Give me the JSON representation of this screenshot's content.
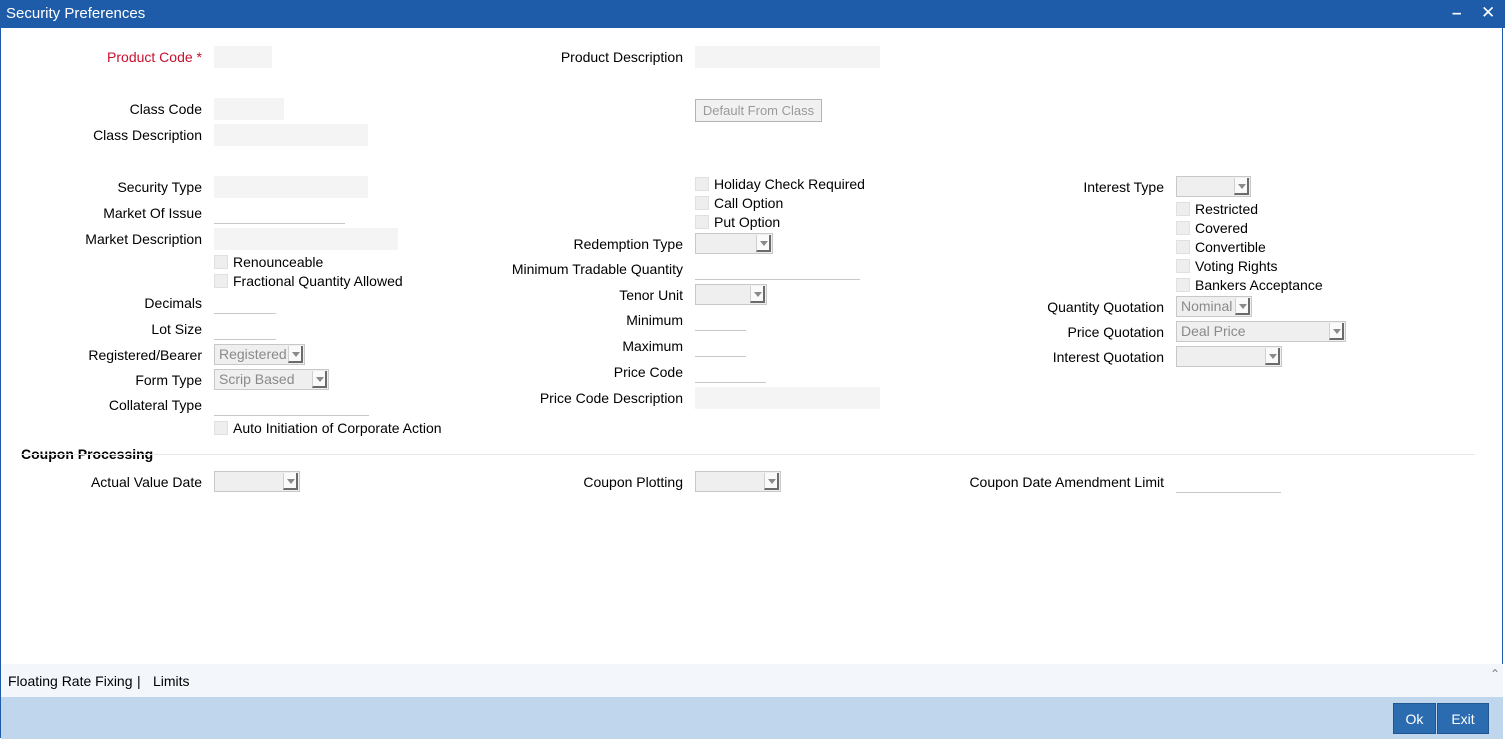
{
  "window": {
    "title": "Security Preferences",
    "minimize_icon": "minimize-icon",
    "close_icon": "close-icon"
  },
  "fields": {
    "product_code": {
      "label": "Product Code",
      "required_mark": "*"
    },
    "product_description": {
      "label": "Product Description"
    },
    "class_code": {
      "label": "Class Code"
    },
    "default_from_class": {
      "label": "Default From Class"
    },
    "class_description": {
      "label": "Class Description"
    },
    "security_type": {
      "label": "Security Type"
    },
    "market_of_issue": {
      "label": "Market Of Issue"
    },
    "market_description": {
      "label": "Market Description"
    },
    "renounceable": {
      "label": "Renounceable"
    },
    "fractional_quantity": {
      "label": "Fractional Quantity Allowed"
    },
    "decimals": {
      "label": "Decimals"
    },
    "lot_size": {
      "label": "Lot Size"
    },
    "registered_bearer": {
      "label": "Registered/Bearer",
      "value": "Registered"
    },
    "form_type": {
      "label": "Form Type",
      "value": "Scrip Based"
    },
    "collateral_type": {
      "label": "Collateral Type"
    },
    "auto_initiation": {
      "label": "Auto Initiation of Corporate Action"
    },
    "holiday_check": {
      "label": "Holiday Check Required"
    },
    "call_option": {
      "label": "Call Option"
    },
    "put_option": {
      "label": "Put Option"
    },
    "redemption_type": {
      "label": "Redemption Type",
      "value": ""
    },
    "min_tradable_qty": {
      "label": "Minimum Tradable Quantity"
    },
    "tenor_unit": {
      "label": "Tenor Unit",
      "value": ""
    },
    "minimum": {
      "label": "Minimum"
    },
    "maximum": {
      "label": "Maximum"
    },
    "price_code": {
      "label": "Price Code"
    },
    "price_code_description": {
      "label": "Price Code Description"
    },
    "interest_type": {
      "label": "Interest Type",
      "value": ""
    },
    "restricted": {
      "label": "Restricted"
    },
    "covered": {
      "label": "Covered"
    },
    "convertible": {
      "label": "Convertible"
    },
    "voting_rights": {
      "label": "Voting Rights"
    },
    "bankers_acceptance": {
      "label": "Bankers Acceptance"
    },
    "quantity_quotation": {
      "label": "Quantity Quotation",
      "value": "Nominal"
    },
    "price_quotation": {
      "label": "Price Quotation",
      "value": "Deal Price"
    },
    "interest_quotation": {
      "label": "Interest Quotation",
      "value": ""
    }
  },
  "coupon": {
    "section_title": "Coupon Processing",
    "actual_value_date": {
      "label": "Actual Value Date",
      "value": ""
    },
    "coupon_plotting": {
      "label": "Coupon Plotting",
      "value": ""
    },
    "coupon_date_amendment_limit": {
      "label": "Coupon Date Amendment Limit"
    }
  },
  "bottom_links": {
    "floating_rate_fixing": "Floating Rate Fixing",
    "separator": "|",
    "limits": "Limits",
    "collapse_icon": "chevron-up-icon"
  },
  "footer": {
    "ok": "Ok",
    "exit": "Exit"
  }
}
